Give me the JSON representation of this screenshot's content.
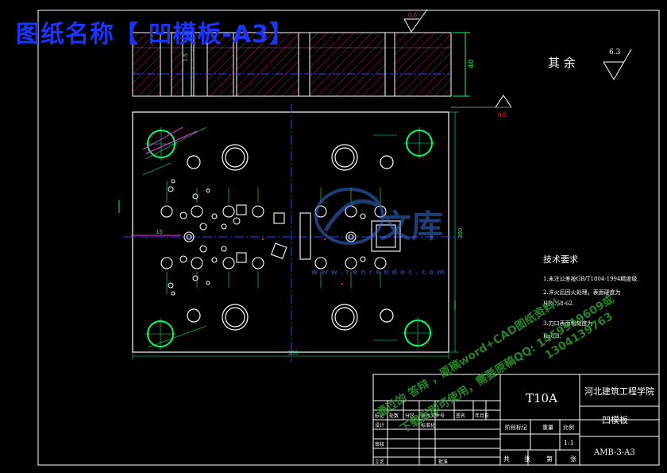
{
  "banner": {
    "title": "图纸名称【 凹模板-A3】"
  },
  "roughness": {
    "rest_label": "其 余",
    "rest_value": "6.3",
    "top_value": "0.8",
    "right_value": "0.8"
  },
  "side_view": {
    "thickness_dim": "40",
    "detail_dim": "1.5"
  },
  "plan_view": {
    "overall_height_dim": "200",
    "overall_width_dim": "300",
    "left_offset_dim": "15"
  },
  "tech_requirements": {
    "heading": "技术要求",
    "items": [
      "1.未注公差按GB/T1804-1994精度级.",
      "2.淬火后回火处理，表面硬度为",
      "HRC58-62.",
      "3.刃口表面粗糙度为",
      "Ra0.8."
    ]
  },
  "title_block": {
    "material": "T10A",
    "school": "河北建筑工程学院",
    "part_name": "凹模板",
    "drawing_no": "AMB-3-A3",
    "scale_label": "比例",
    "scale_value": "1:1",
    "weight_label": "重量",
    "stage_label": "阶段标记",
    "sheet_cells": [
      "共",
      "张",
      "第",
      "张"
    ],
    "revision_headers": [
      "标记",
      "处数",
      "分区",
      "更改文件号",
      "签名",
      "年月日"
    ],
    "role_labels": [
      "设计",
      "审核",
      "工艺",
      "标准化",
      "批准"
    ]
  },
  "watermark": {
    "logo_text": "文库",
    "url_text": "www.renrendoc.com",
    "line1": "通过的 答辩 ，原稿word+CAD图纸资料！",
    "line2": "下载后即可使用，需要原稿QQ: 1459919609或",
    "line3": "1304139763"
  },
  "colors": {
    "background": "#000000",
    "outline": "#ffffff",
    "hatch": "#c0155a",
    "centerline": "#3040ff",
    "hole": "#00ff66",
    "dim": "#00ff66",
    "marker": "#ff2020",
    "banner": "#1a35ff"
  }
}
